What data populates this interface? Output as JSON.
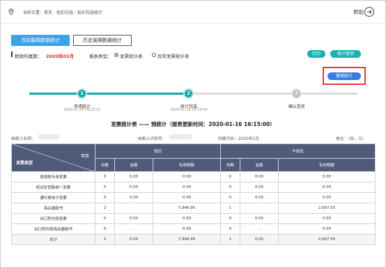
{
  "header": {
    "breadcrumb": "当前位置：首页 - 抵扣勾选 - 抵扣勾选统计",
    "help": "帮助"
  },
  "tabs": [
    {
      "label": "当前属期数据统计",
      "active": true
    },
    {
      "label": "历史属期数据统计",
      "active": false
    }
  ],
  "filter": {
    "period_label": "税款所属期：",
    "period_value": "2020年01月",
    "report_type_label": "报表类型：",
    "options": [
      {
        "label": "发票统计表",
        "selected": true
      },
      {
        "label": "异常发票统计表",
        "selected": false
      }
    ]
  },
  "buttons": {
    "print": "打印",
    "query": "统计查询",
    "retotal": "撤销统计"
  },
  "steps": [
    {
      "num": "1",
      "name": "申请统计",
      "time": "2020-01-16 16:10:51",
      "done": true
    },
    {
      "num": "2",
      "name": "统计完成",
      "time": "2020-01-16 16:15:00",
      "done": true
    },
    {
      "num": "3",
      "name": "确认签名",
      "time": "",
      "done": false
    }
  ],
  "report": {
    "title": "发票统计表 —— 预统计（报表更新时间：2020-01-16 16:15:00）",
    "taxpayer_name_label": "纳税人名称：",
    "taxpayer_id_label": "纳税人识别号：",
    "period_label": "所属月份：2020年1月",
    "unit_label": "单位：（份，元）"
  },
  "table": {
    "corner_type": "发票类型",
    "corner_item": "项目",
    "group_deduct": "抵扣",
    "group_nondeduct": "不抵扣",
    "sub_headers": [
      "份数",
      "金额",
      "有效税额",
      "份数",
      "金额",
      "有效税额"
    ],
    "rows": [
      {
        "name": "增值税专用发票",
        "cells": [
          "0",
          "0.00",
          "0.00",
          "0",
          "0.00",
          "0.00"
        ]
      },
      {
        "name": "机动车销售统一发票",
        "cells": [
          "0",
          "0.00",
          "0.00",
          "0",
          "0.00",
          "0.00"
        ]
      },
      {
        "name": "通行费电子发票",
        "cells": [
          "0",
          "0.00",
          "0.00",
          "0",
          "0.00",
          "0.00"
        ]
      },
      {
        "name": "海关缴款书",
        "cells": [
          "2",
          "-",
          "7,946.95",
          "1",
          "-",
          "2,697.55"
        ]
      },
      {
        "name": "出口转内销发票",
        "cells": [
          "0",
          "0.00",
          "0.00",
          "0",
          "0.00",
          "0.00"
        ]
      },
      {
        "name": "出口转内销海关缴款书",
        "cells": [
          "0",
          "-",
          "0.00",
          "0",
          "-",
          "0.00"
        ]
      },
      {
        "name": "总计",
        "cells": [
          "2",
          "0.00",
          "7,946.95",
          "1",
          "0.00",
          "2,697.55"
        ]
      }
    ]
  },
  "colors": {
    "accent_blue": "#3aa4e6",
    "teal": "#16b3b3",
    "header_navy": "#4f5b78",
    "highlight_red": "#e53935",
    "period_red": "#d9232d"
  }
}
